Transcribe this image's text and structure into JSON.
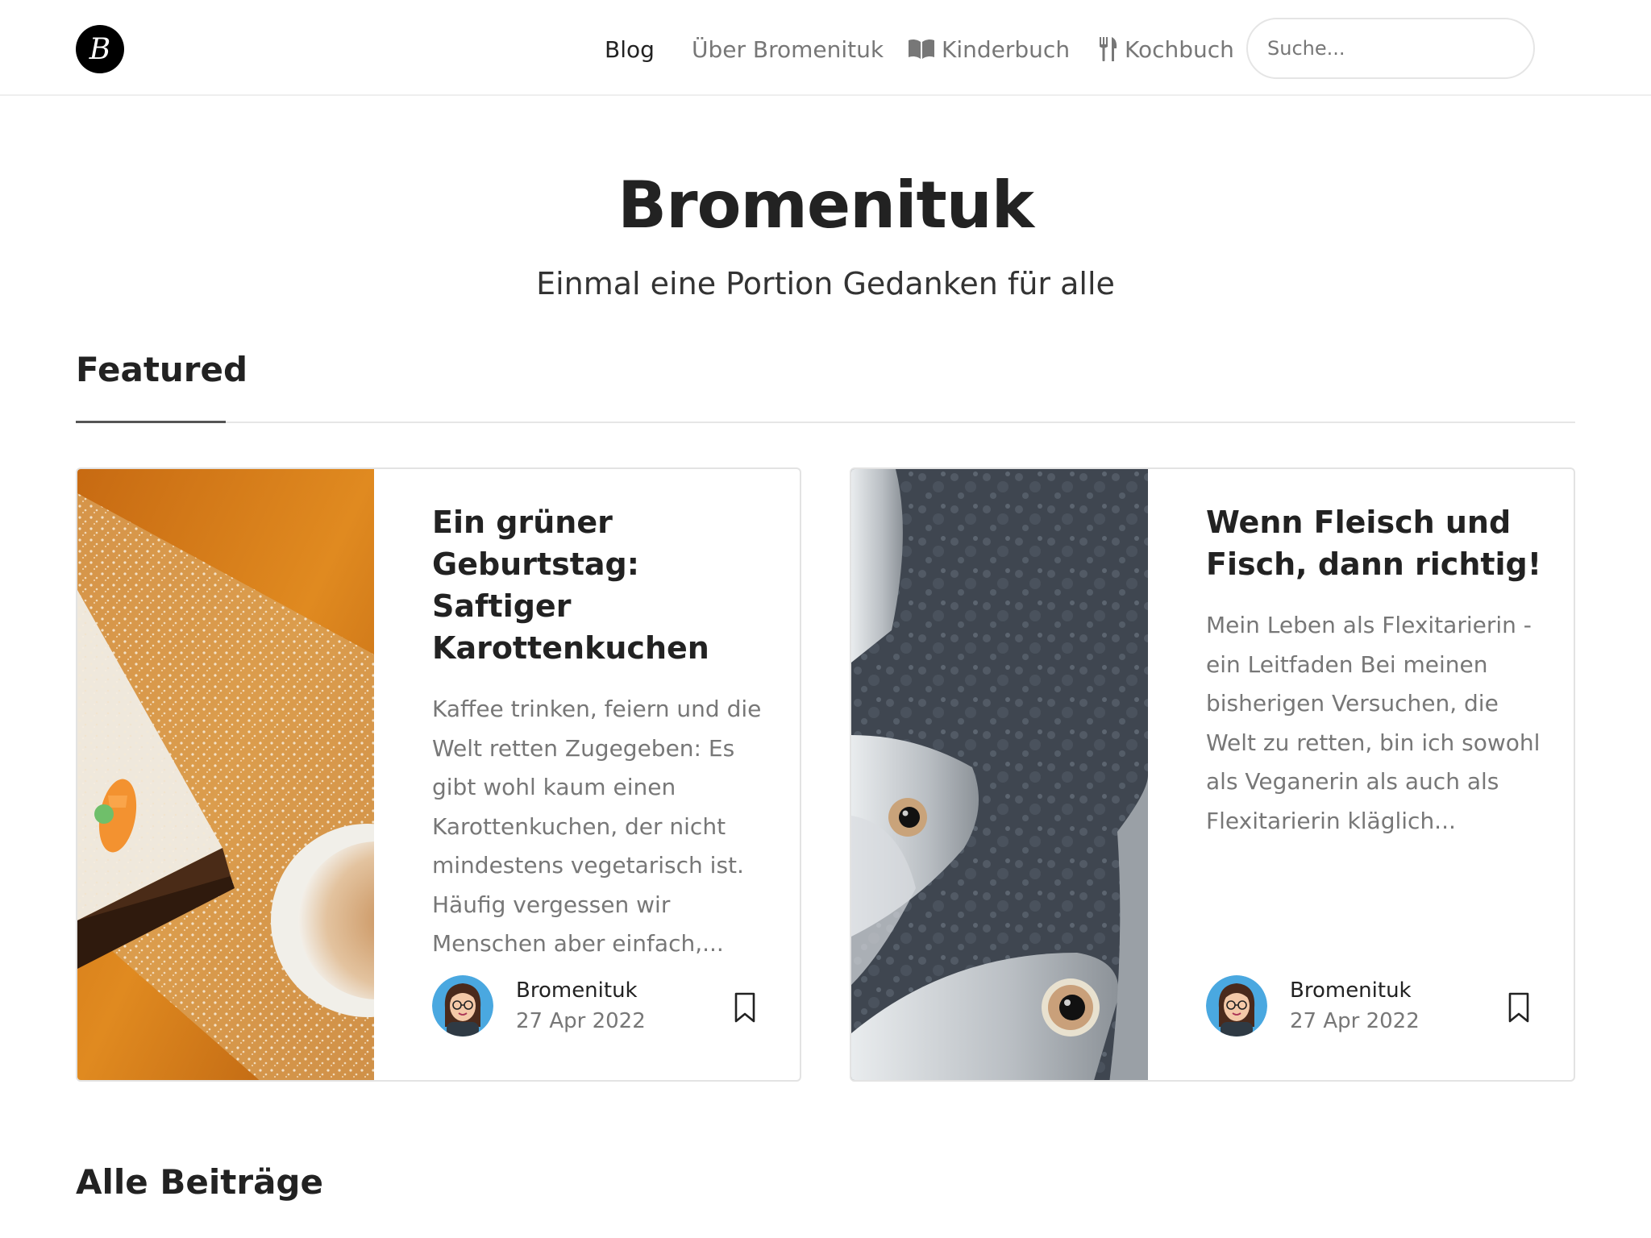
{
  "header": {
    "logo_letter": "B",
    "nav": [
      {
        "label": "Blog",
        "icon": ""
      },
      {
        "label": "Über Bromenituk",
        "icon": ""
      },
      {
        "label": "Kinderbuch",
        "icon": "book-open-icon"
      },
      {
        "label": "Kochbuch",
        "icon": "utensils-icon"
      }
    ],
    "search_placeholder": "Suche..."
  },
  "hero": {
    "title": "Bromenituk",
    "tagline": "Einmal eine Portion Gedanken für alle"
  },
  "featured": {
    "heading": "Featured",
    "posts": [
      {
        "title": "Ein grüner Geburtstag: Saftiger Karottenkuchen",
        "excerpt": "Kaffee trinken, feiern und die Welt retten Zugegeben: Es gibt wohl kaum einen Karottenkuchen, der nicht mindestens vegetarisch ist. Häufig vergessen wir Menschen aber einfach,...",
        "author": "Bromenituk",
        "date": "27 Apr 2022"
      },
      {
        "title": "Wenn Fleisch und Fisch, dann richtig!",
        "excerpt": "Mein Leben als Flexitarierin - ein Leitfaden Bei meinen bisherigen Versuchen, die Welt zu retten, bin ich sowohl als Veganerin als auch als Flexitarierin kläglich...",
        "author": "Bromenituk",
        "date": "27 Apr 2022"
      }
    ]
  },
  "all_posts": {
    "heading": "Alle Beiträge"
  }
}
